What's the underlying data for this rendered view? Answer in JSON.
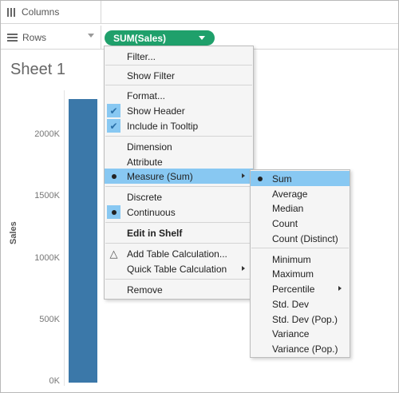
{
  "shelves": {
    "columns_label": "Columns",
    "rows_label": "Rows",
    "pill_label": "SUM(Sales)"
  },
  "sheet": {
    "title": "Sheet 1",
    "axis_title": "Sales",
    "ticks": [
      "2000K",
      "1500K",
      "1000K",
      "500K",
      "0K"
    ],
    "bar_value": 2300000,
    "bar_color": "#3b78a9"
  },
  "menu": {
    "items": [
      {
        "label": "Filter..."
      },
      {
        "label": "Show Filter"
      },
      {
        "label": "Format..."
      },
      {
        "label": "Show Header",
        "checked": true
      },
      {
        "label": "Include in Tooltip",
        "checked": true
      },
      {
        "label": "Dimension"
      },
      {
        "label": "Attribute"
      },
      {
        "label": "Measure (Sum)",
        "selected": true,
        "submenu": true
      },
      {
        "label": "Discrete"
      },
      {
        "label": "Continuous",
        "selected": true
      },
      {
        "label": "Edit in Shelf"
      },
      {
        "label": "Add Table Calculation..."
      },
      {
        "label": "Quick Table Calculation",
        "submenu": true
      },
      {
        "label": "Remove"
      }
    ]
  },
  "submenu": {
    "items": [
      {
        "label": "Sum",
        "selected": true
      },
      {
        "label": "Average"
      },
      {
        "label": "Median"
      },
      {
        "label": "Count"
      },
      {
        "label": "Count (Distinct)"
      },
      {
        "label": "Minimum"
      },
      {
        "label": "Maximum"
      },
      {
        "label": "Percentile",
        "submenu": true
      },
      {
        "label": "Std. Dev"
      },
      {
        "label": "Std. Dev (Pop.)"
      },
      {
        "label": "Variance"
      },
      {
        "label": "Variance (Pop.)"
      }
    ]
  },
  "colors": {
    "pill": "#1fa06b",
    "highlight": "#88c8f2"
  }
}
